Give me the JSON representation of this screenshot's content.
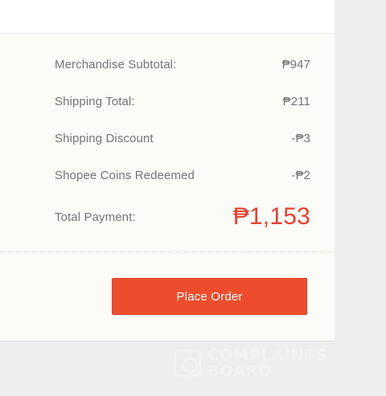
{
  "summary": {
    "rows": [
      {
        "label": "Merchandise Subtotal:",
        "value": "₱947"
      },
      {
        "label": "Shipping Total:",
        "value": "₱211"
      },
      {
        "label": "Shipping Discount",
        "value": "-₱3"
      },
      {
        "label": "Shopee Coins Redeemed",
        "value": "-₱2"
      }
    ],
    "total": {
      "label": "Total Payment:",
      "value": "₱1,153"
    }
  },
  "actions": {
    "place_order_label": "Place Order"
  },
  "colors": {
    "accent": "#ee4d2d",
    "total_text": "#e5412f",
    "background": "#fbfbf8"
  },
  "watermark": {
    "line1": "COMPLAINTS",
    "line2": "BOARD",
    "icon": "complaints-board-logo-icon"
  }
}
